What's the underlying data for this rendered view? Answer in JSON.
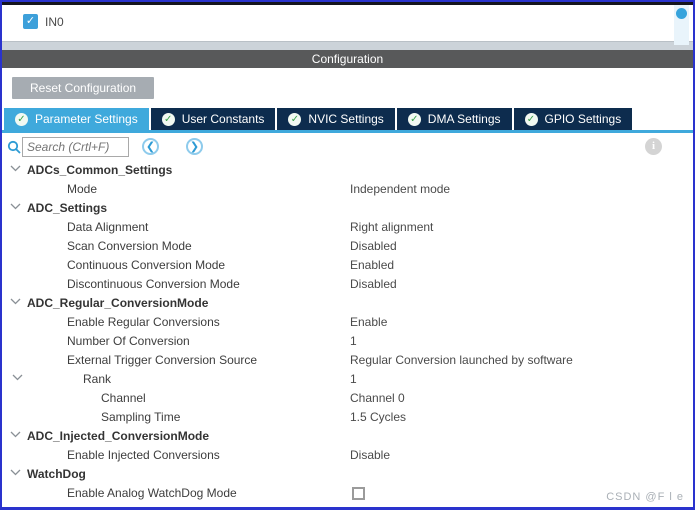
{
  "top_panel": {
    "checkbox_label": "IN0",
    "checkbox_checked": true,
    "check_glyph": "✓"
  },
  "header": {
    "title": "Configuration"
  },
  "toolbar": {
    "reset_label": "Reset Configuration"
  },
  "tabs": {
    "check_glyph": "✓",
    "items": [
      {
        "label": "Parameter Settings",
        "active": true
      },
      {
        "label": "User Constants",
        "active": false
      },
      {
        "label": "NVIC Settings",
        "active": false
      },
      {
        "label": "DMA Settings",
        "active": false
      },
      {
        "label": "GPIO Settings",
        "active": false
      }
    ]
  },
  "search": {
    "placeholder": "Search (Crtl+F)",
    "prev_glyph": "❮",
    "next_glyph": "❯",
    "info_glyph": "i"
  },
  "tree": {
    "rows": [
      {
        "label": "ADCs_Common_Settings",
        "type": "group",
        "value": ""
      },
      {
        "label": "Mode",
        "type": "item",
        "value": "Independent mode"
      },
      {
        "label": "ADC_Settings",
        "type": "group",
        "value": ""
      },
      {
        "label": "Data Alignment",
        "type": "item",
        "value": "Right alignment"
      },
      {
        "label": "Scan Conversion Mode",
        "type": "item",
        "value": "Disabled"
      },
      {
        "label": "Continuous Conversion Mode",
        "type": "item",
        "value": "Enabled"
      },
      {
        "label": "Discontinuous Conversion Mode",
        "type": "item",
        "value": "Disabled"
      },
      {
        "label": "ADC_Regular_ConversionMode",
        "type": "group",
        "value": ""
      },
      {
        "label": "Enable Regular Conversions",
        "type": "item",
        "value": "Enable"
      },
      {
        "label": "Number Of Conversion",
        "type": "item",
        "value": "1"
      },
      {
        "label": "External Trigger Conversion Source",
        "type": "item",
        "value": "Regular Conversion launched by software"
      },
      {
        "label": "Rank",
        "type": "rank",
        "value": "1"
      },
      {
        "label": "Channel",
        "type": "subitem",
        "value": "Channel 0"
      },
      {
        "label": "Sampling Time",
        "type": "subitem",
        "value": "1.5 Cycles"
      },
      {
        "label": "ADC_Injected_ConversionMode",
        "type": "group",
        "value": ""
      },
      {
        "label": "Enable Injected Conversions",
        "type": "item",
        "value": "Disable"
      },
      {
        "label": "WatchDog",
        "type": "group",
        "value": ""
      },
      {
        "label": "Enable Analog WatchDog Mode",
        "type": "checkbox",
        "value": "unchecked"
      }
    ]
  },
  "watermark": "CSDN @F l e",
  "colors": {
    "window_border": "#2a33cd",
    "active_tab": "#3fa9dc",
    "inactive_tab": "#0d2c4e",
    "header_bar": "#58595a",
    "check_green": "#3aa24a",
    "checkbox_blue": "#3da0da",
    "scroll_thumb": "#36a3dc"
  }
}
